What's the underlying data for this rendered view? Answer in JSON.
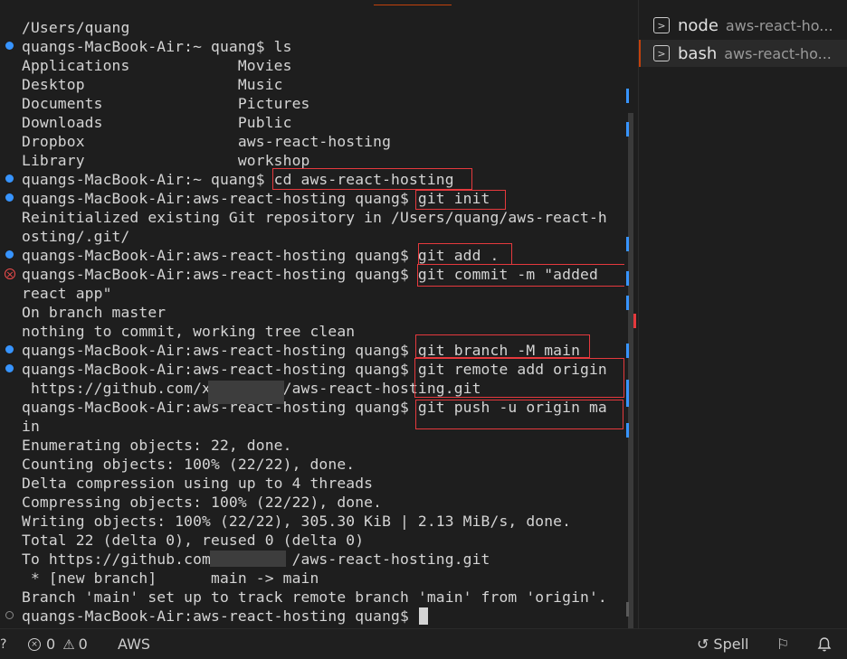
{
  "terminal": {
    "lines": [
      "/Users/quang",
      "quangs-MacBook-Air:~ quang$ ls",
      "Applications            Movies",
      "Desktop                 Music",
      "Documents               Pictures",
      "Downloads               Public",
      "Dropbox                 aws-react-hosting",
      "Library                 workshop",
      "quangs-MacBook-Air:~ quang$ cd aws-react-hosting",
      "quangs-MacBook-Air:aws-react-hosting quang$ git init",
      "Reinitialized existing Git repository in /Users/quang/aws-react-h",
      "osting/.git/",
      "quangs-MacBook-Air:aws-react-hosting quang$ git add .",
      "quangs-MacBook-Air:aws-react-hosting quang$ git commit -m \"added",
      "react app\"",
      "On branch master",
      "nothing to commit, working tree clean",
      "quangs-MacBook-Air:aws-react-hosting quang$ git branch -M main",
      "quangs-MacBook-Air:aws-react-hosting quang$ git remote add origin",
      " https://github.com/x        /aws-react-hosting.git",
      "quangs-MacBook-Air:aws-react-hosting quang$ git push -u origin ma",
      "in",
      "Enumerating objects: 22, done.",
      "Counting objects: 100% (22/22), done.",
      "Delta compression using up to 4 threads",
      "Compressing objects: 100% (22/22), done.",
      "Writing objects: 100% (22/22), 305.30 KiB | 2.13 MiB/s, done.",
      "Total 22 (delta 0), reused 0 (delta 0)",
      "To https://github.com/        /aws-react-hosting.git",
      " * [new branch]      main -> main",
      "Branch 'main' set up to track remote branch 'main' from 'origin'.",
      "quangs-MacBook-Air:aws-react-hosting quang$ "
    ]
  },
  "panel": {
    "terminals": [
      {
        "name": "node",
        "desc": "aws-react-ho...",
        "active": false,
        "icon": "terminal-icon"
      },
      {
        "name": "bash",
        "desc": "aws-react-ho...",
        "active": true,
        "icon": "terminal-icon"
      }
    ]
  },
  "statusbar": {
    "errors": "0",
    "warnings": "0",
    "aws": "AWS",
    "spell": "Spell"
  },
  "colors": {
    "background": "#1e1e1e",
    "text": "#d4d4d4",
    "success_dot": "#3794ff",
    "error_dot": "#f14c4c",
    "highlight_box": "#e5393d"
  }
}
